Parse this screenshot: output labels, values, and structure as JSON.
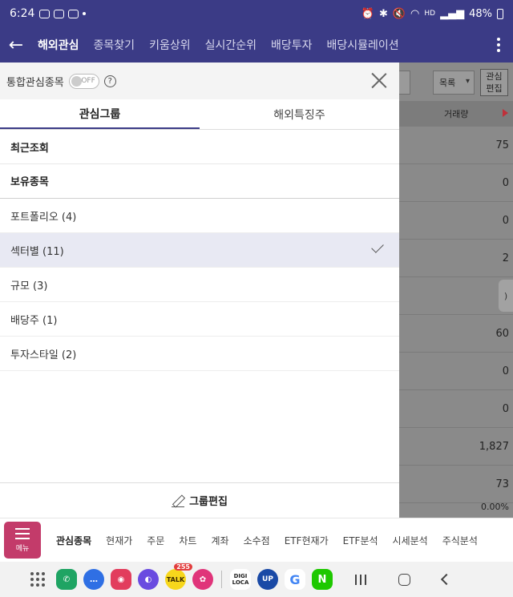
{
  "status_bar": {
    "time": "6:24",
    "network": "HD",
    "battery": "48%"
  },
  "top_nav": {
    "tabs": [
      "해외관심",
      "종목찾기",
      "키움상위",
      "실시간순위",
      "배당투자",
      "배당시뮬레이션"
    ],
    "active_tab": "해외관심"
  },
  "panel": {
    "header_label": "통합관심종목",
    "toggle_state": "OFF",
    "help": "?",
    "tabs": [
      "관심그룹",
      "해외특징주"
    ],
    "active_tab": "관심그룹",
    "fixed_groups": [
      "최근조회",
      "보유종목"
    ],
    "user_groups": [
      {
        "label": "포트폴리오 (4)",
        "selected": false
      },
      {
        "label": "섹터별 (11)",
        "selected": true
      },
      {
        "label": "규모 (3)",
        "selected": false
      },
      {
        "label": "배당주 (1)",
        "selected": false
      },
      {
        "label": "투자스타일 (2)",
        "selected": false
      }
    ],
    "footer_button": "그룹편집"
  },
  "background_list": {
    "select_value": "목록",
    "edit_button": "관심\n편집",
    "column_header": "거래량",
    "values": [
      "75",
      "0",
      "0",
      "2",
      ")",
      "60",
      "0",
      "0",
      "1,827",
      "73",
      "0.00%"
    ]
  },
  "bottom_bar": {
    "menu_label": "메뉴",
    "tabs": [
      "관심종목",
      "현재가",
      "주문",
      "차트",
      "계좌",
      "소수점",
      "ETF현재가",
      "ETF분석",
      "시세분석",
      "주식분석"
    ],
    "active_tab": "관심종목"
  },
  "dock": {
    "apps": [
      {
        "icon": "phone-app-icon",
        "label": "",
        "color": "#1fa463"
      },
      {
        "icon": "messages-app-icon",
        "label": "",
        "color": "#2f6fe4"
      },
      {
        "icon": "camera-app-icon",
        "label": "",
        "color": "#e23d5d"
      },
      {
        "icon": "internet-app-icon",
        "label": "",
        "color": "#6a4be0"
      },
      {
        "icon": "kakaotalk-app-icon",
        "label": "TALK",
        "color": "#f7d71c",
        "badge": "255"
      },
      {
        "icon": "flower-app-icon",
        "label": "",
        "color": "#e0347a"
      },
      {
        "icon": "digiloca-app-icon",
        "label": "DIGI\nLOCA",
        "color": "#ffffff"
      },
      {
        "icon": "up-app-icon",
        "label": "UP",
        "color": "#1a4aa6"
      },
      {
        "icon": "google-app-icon",
        "label": "G",
        "color": "#ffffff"
      },
      {
        "icon": "naver-app-icon",
        "label": "N",
        "color": "#1ec800"
      }
    ]
  },
  "colors": {
    "header": "#3b3b86",
    "menu_button": "#c33b6a",
    "selected_row": "#e8e9f3"
  }
}
